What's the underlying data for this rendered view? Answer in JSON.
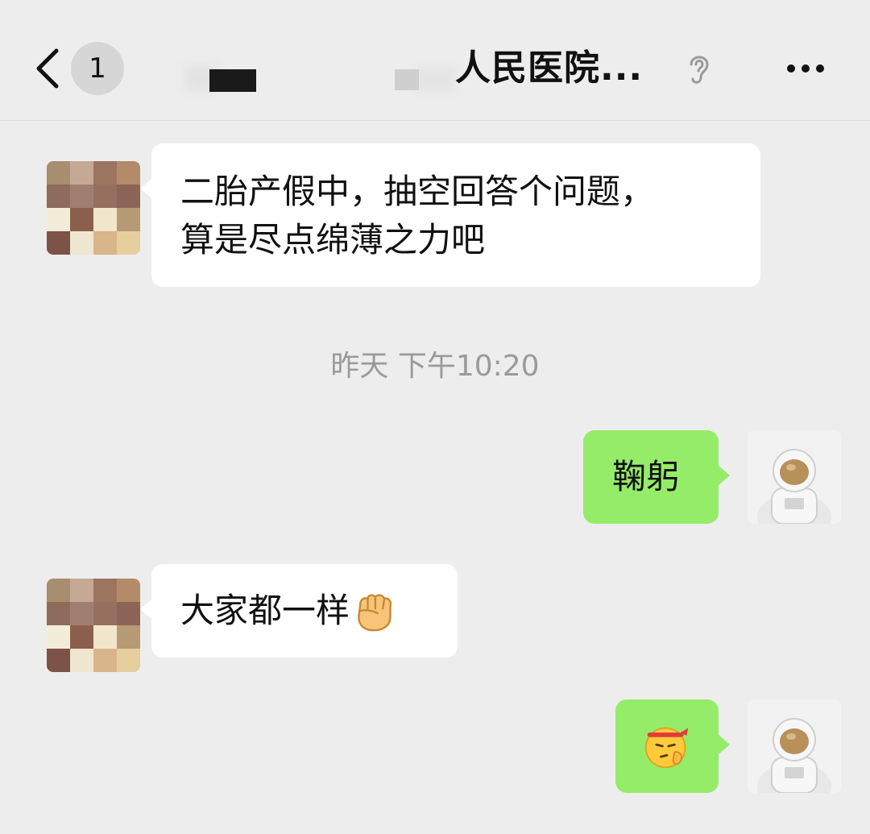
{
  "header": {
    "unread_count": "1",
    "title": "人民医院..."
  },
  "messages": [
    {
      "side": "left",
      "lines": [
        "二胎产假中，抽空回答个问题，",
        "算是尽点绵薄之力吧"
      ]
    },
    {
      "side": "right",
      "text": "鞠躬"
    },
    {
      "side": "left",
      "text": "大家都一样"
    },
    {
      "side": "right",
      "emoji": "saluting-face-emoji"
    }
  ],
  "timestamp": "昨天 下午10:20",
  "icons": {
    "back": "chevron-left-icon",
    "voice_mute": "ear-icon",
    "more": "more-dots-icon",
    "fist": "raised-fist-emoji"
  },
  "colors": {
    "background": "#ededed",
    "bubble_left": "#ffffff",
    "bubble_right": "#95ec69"
  }
}
